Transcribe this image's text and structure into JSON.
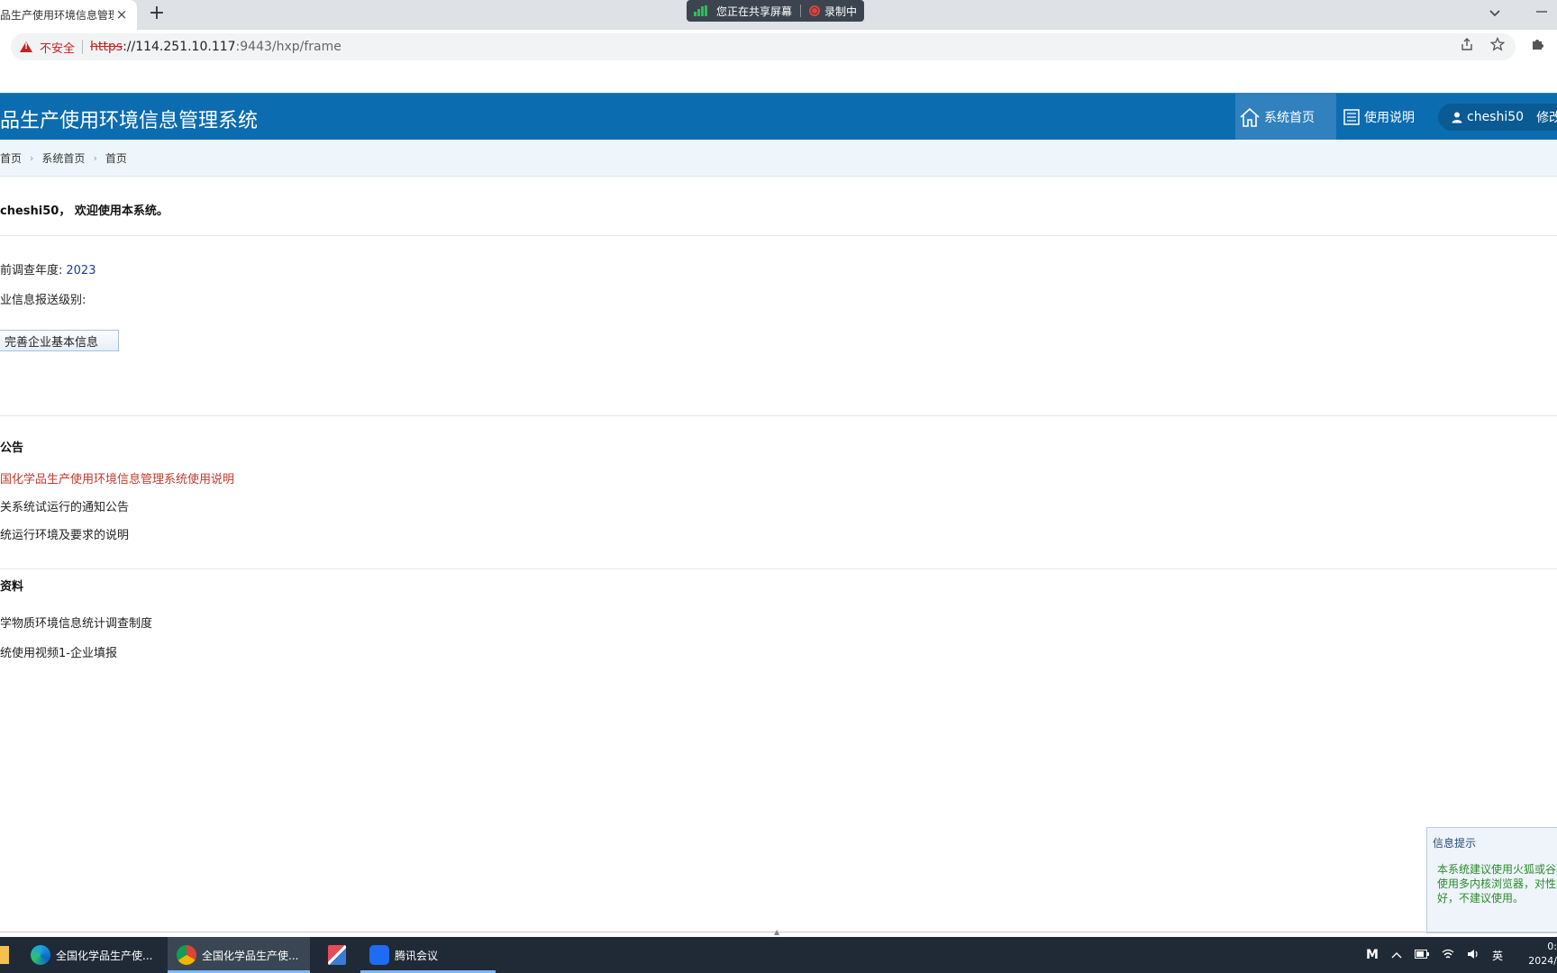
{
  "browser": {
    "tab_title": "品生产使用环境信息管理",
    "tab_close": "×",
    "new_tab": "+",
    "security_label": "不安全",
    "url_scheme": "https",
    "url_host": "://114.251.10.117",
    "url_rest": ":9443/hxp/frame",
    "sharing_label": "您正在共享屏幕",
    "recording_label": "录制中"
  },
  "app": {
    "title": "品生产使用环境信息管理系统",
    "nav": {
      "home_label": "系统首页",
      "help_label": "使用说明"
    },
    "user": {
      "name": "cheshi50",
      "edit_label": "修改"
    }
  },
  "breadcrumb": [
    "首页",
    "系统首页",
    "首页"
  ],
  "content": {
    "welcome": "cheshi50， 欢迎使用本系统。",
    "survey_year_label": "前调查年度:",
    "survey_year_value": "2023",
    "report_level_label": "业信息报送级别:",
    "complete_button": "完善企业基本信息",
    "notices": {
      "title": "公告",
      "items": [
        "国化学品生产使用环境信息管理系统使用说明",
        "关系统试运行的通知公告",
        "统运行环境及要求的说明"
      ]
    },
    "materials": {
      "title": "资料",
      "items": [
        "学物质环境信息统计调查制度",
        "统使用视频1-企业填报"
      ]
    }
  },
  "popup": {
    "title": "信息提示",
    "body": "本系统建议使用火狐或谷荐使用多内核浏览器，对性不好，不建议使用。"
  },
  "taskbar": {
    "items": [
      {
        "label": "全国化学品生产使..."
      },
      {
        "label": "全国化学品生产使..."
      },
      {
        "label": ""
      },
      {
        "label": "腾讯会议"
      }
    ],
    "ime": "英",
    "clock_time": "0:",
    "clock_date": "2024/"
  },
  "colors": {
    "header_bg": "#0c6cb0",
    "nav_active_bg": "#3181be",
    "breadcrumb_bg": "#eef6fb",
    "notice_highlight": "#c0392b",
    "popup_text": "#2d8a2d"
  }
}
